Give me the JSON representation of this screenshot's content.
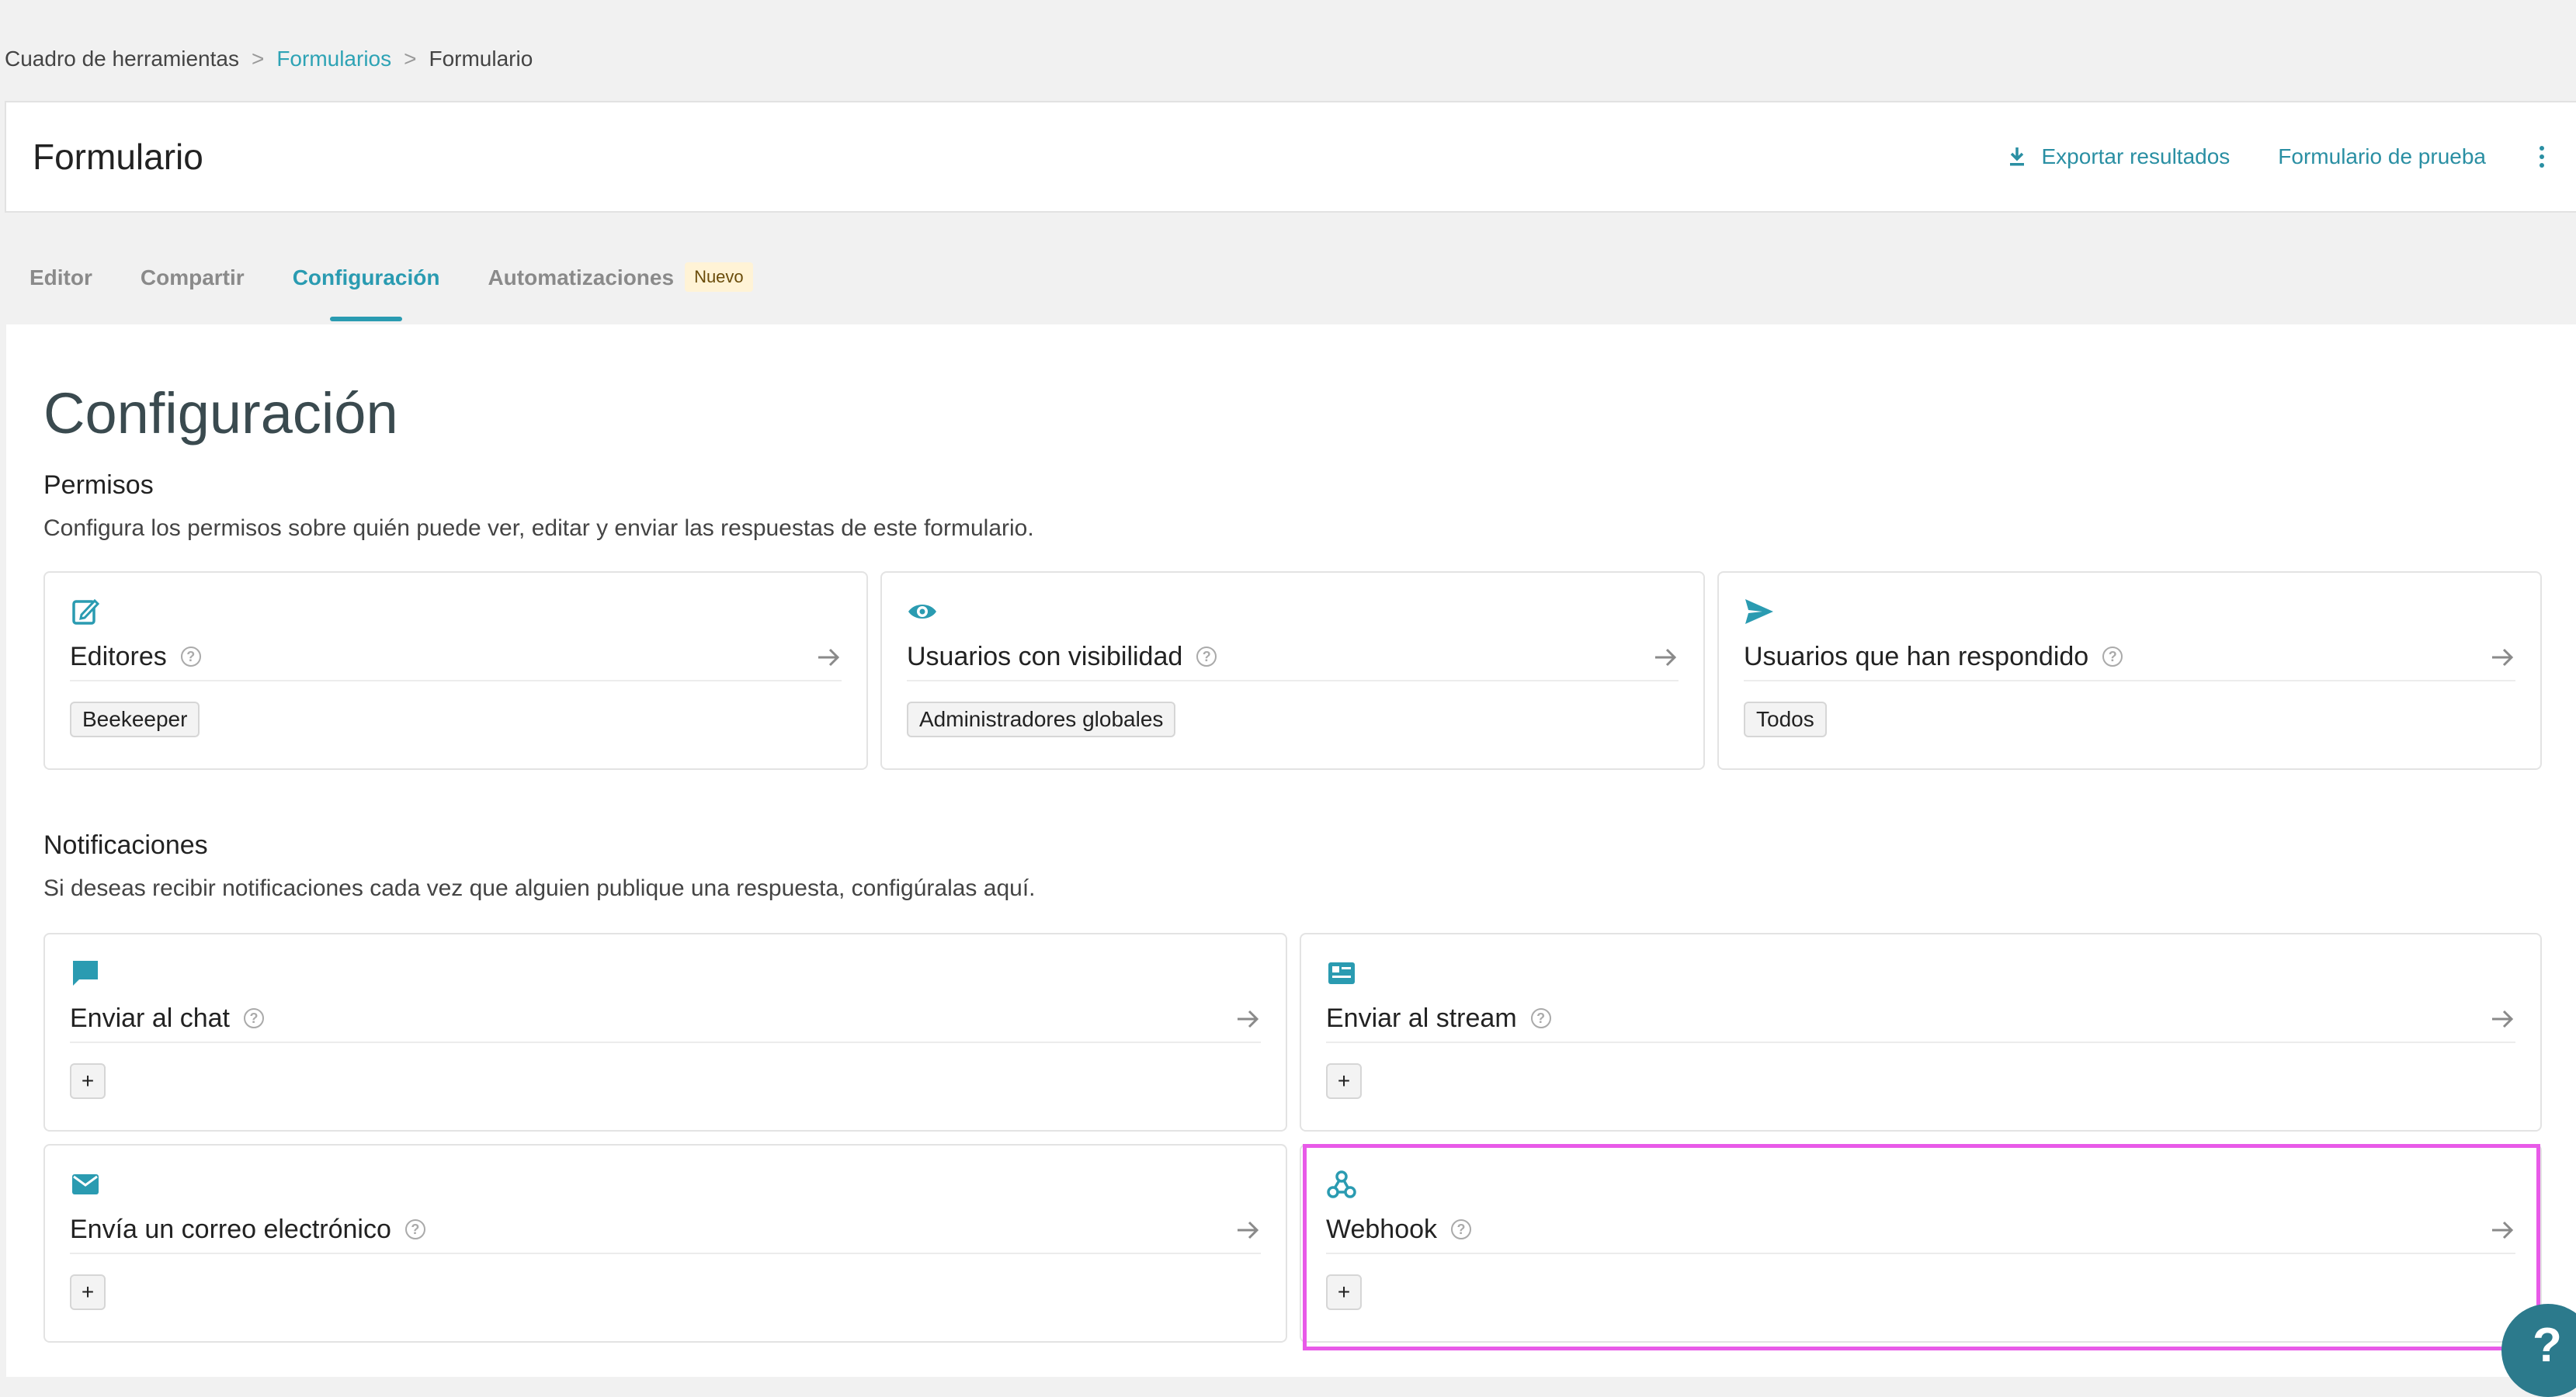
{
  "breadcrumb": {
    "root": "Cuadro de herramientas",
    "sep1": ">",
    "forms": "Formularios",
    "sep2": ">",
    "current": "Formulario"
  },
  "header": {
    "title": "Formulario",
    "export_label": "Exportar resultados",
    "test_label": "Formulario de prueba"
  },
  "tabs": [
    {
      "label": "Editor"
    },
    {
      "label": "Compartir"
    },
    {
      "label": "Configuración",
      "active": true
    },
    {
      "label": "Automatizaciones",
      "badge": "Nuevo"
    }
  ],
  "page": {
    "title": "Configuración"
  },
  "permissions": {
    "title": "Permisos",
    "description": "Configura los permisos sobre quién puede ver, editar y enviar las respuestas de este formulario.",
    "cards": [
      {
        "icon": "edit-icon",
        "label": "Editores",
        "value": "Beekeeper"
      },
      {
        "icon": "eye-icon",
        "label": "Usuarios con visibilidad",
        "value": "Administradores globales"
      },
      {
        "icon": "send-icon",
        "label": "Usuarios que han respondido",
        "value": "Todos"
      }
    ]
  },
  "notifications": {
    "title": "Notificaciones",
    "description": "Si deseas recibir notificaciones cada vez que alguien publique una respuesta, configúralas aquí.",
    "cards": [
      {
        "icon": "chat-icon",
        "label": "Enviar al chat",
        "action": "+"
      },
      {
        "icon": "stream-icon",
        "label": "Enviar al stream",
        "action": "+"
      },
      {
        "icon": "mail-icon",
        "label": "Envía un correo electrónico",
        "action": "+"
      },
      {
        "icon": "webhook-icon",
        "label": "Webhook",
        "action": "+"
      }
    ]
  },
  "help": {
    "symbol": "?"
  },
  "colors": {
    "accent": "#2a9bb1",
    "highlight": "#e85ae8",
    "badge_bg": "#fff3d6"
  }
}
